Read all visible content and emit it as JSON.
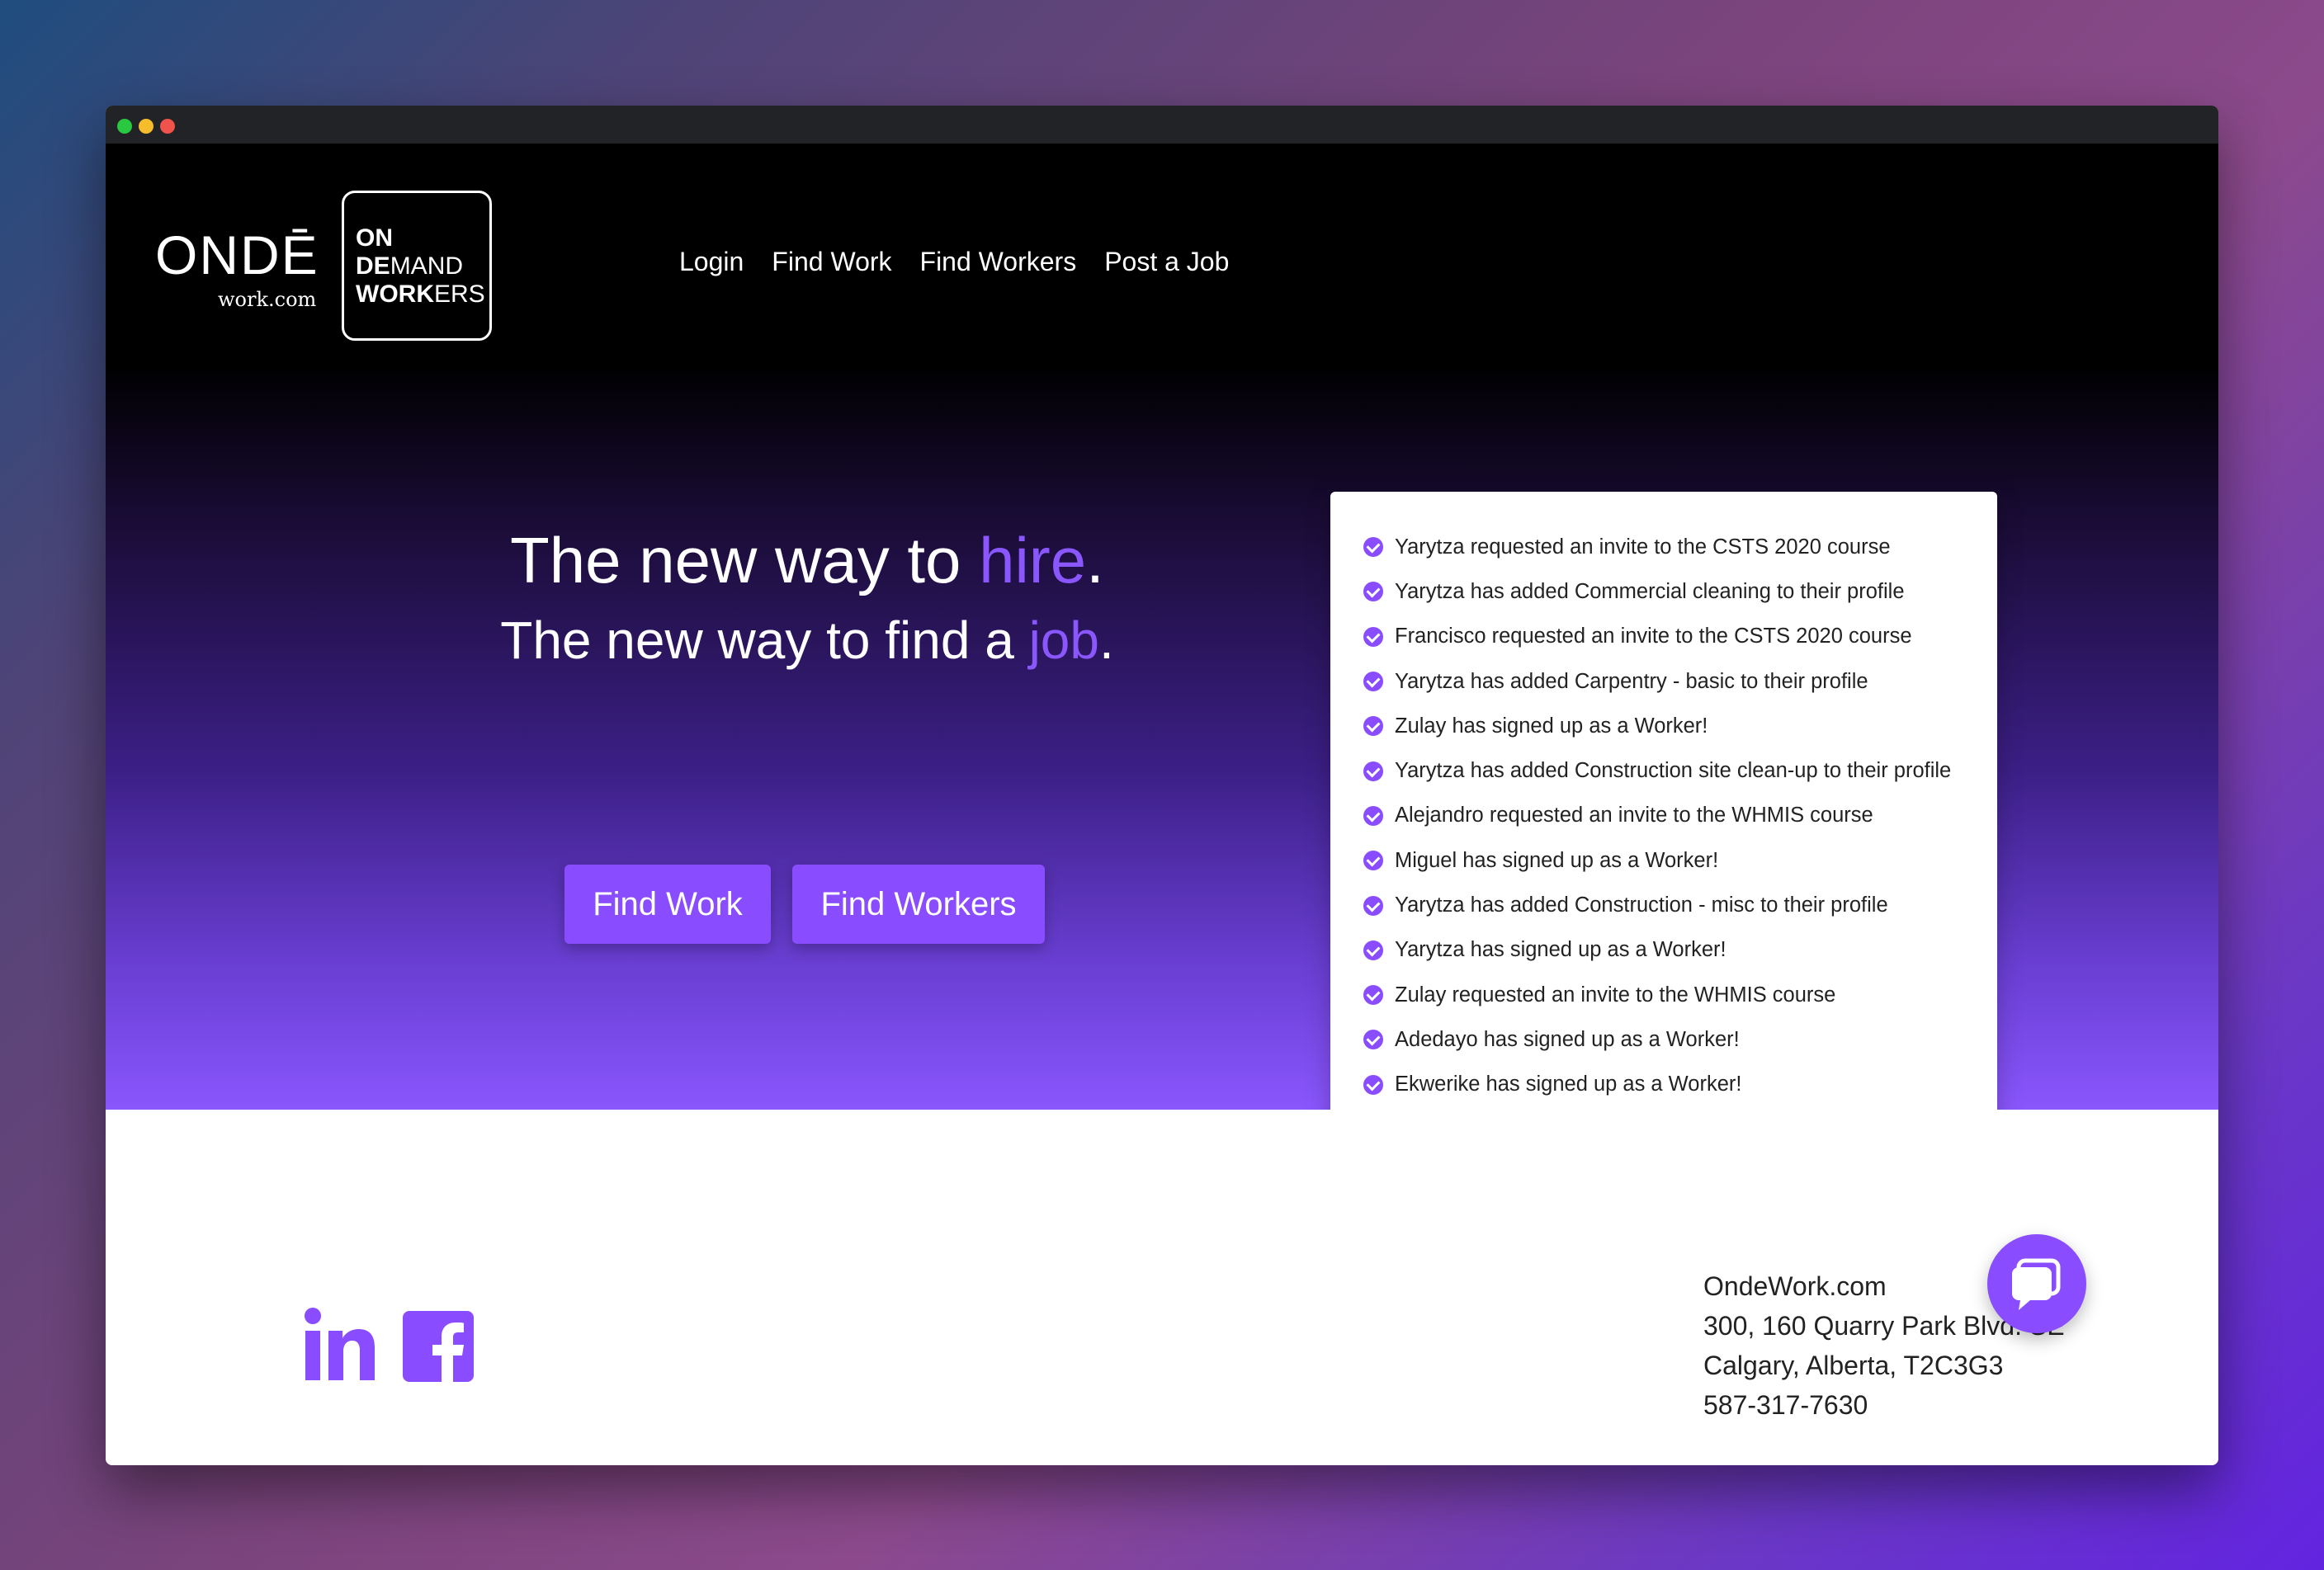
{
  "logo": {
    "word": "ONDĒ",
    "sub": "work.com",
    "box_lines": [
      {
        "bold": "ON",
        "rest": ""
      },
      {
        "bold": "DE",
        "rest": "MAND"
      },
      {
        "bold": "WORK",
        "rest": "ERS"
      }
    ]
  },
  "nav": [
    "Login",
    "Find Work",
    "Find Workers",
    "Post a Job"
  ],
  "hero": {
    "line1_prefix": "The new way to ",
    "line1_accent": "hire",
    "line1_suffix": ".",
    "line2_prefix": "The new way to find a ",
    "line2_accent": "job",
    "line2_suffix": ".",
    "buttons": [
      "Find Work",
      "Find Workers"
    ]
  },
  "activity": [
    "Yarytza requested an invite to the CSTS 2020 course",
    "Yarytza has added Commercial cleaning to their profile",
    "Francisco requested an invite to the CSTS 2020 course",
    "Yarytza has added Carpentry - basic to their profile",
    "Zulay has signed up as a Worker!",
    "Yarytza has added Construction site clean-up to their profile",
    "Alejandro requested an invite to the WHMIS course",
    "Miguel has signed up as a Worker!",
    "Yarytza has added Construction - misc to their profile",
    "Yarytza has signed up as a Worker!",
    "Zulay requested an invite to the WHMIS course",
    "Adedayo has signed up as a Worker!",
    "Ekwerike has signed up as a Worker!"
  ],
  "footer": {
    "social": [
      "linkedin-icon",
      "facebook-icon"
    ],
    "address": [
      "OndeWork.com",
      "300, 160 Quarry Park Blvd. SE",
      "Calgary, Alberta, T2C3G3",
      "587-317-7630"
    ]
  },
  "colors": {
    "accent": "#8a4cff",
    "titlebar": "#222327"
  }
}
